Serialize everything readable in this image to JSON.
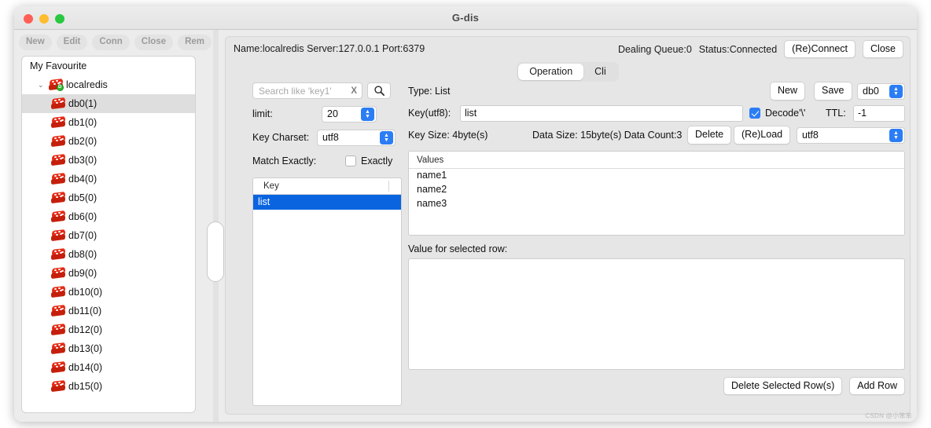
{
  "window": {
    "title": "G-dis"
  },
  "left_toolbar": {
    "buttons": [
      {
        "label": "New",
        "name": "new"
      },
      {
        "label": "Edit",
        "name": "edit"
      },
      {
        "label": "Conn",
        "name": "conn"
      },
      {
        "label": "Close",
        "name": "close"
      },
      {
        "label": "Rem",
        "name": "rem"
      }
    ]
  },
  "sidebar": {
    "root_label": "My Favourite",
    "server_label": "localredis",
    "caret": "⌄",
    "databases": [
      {
        "label": "db0(1)",
        "selected": true
      },
      {
        "label": "db1(0)",
        "selected": false
      },
      {
        "label": "db2(0)",
        "selected": false
      },
      {
        "label": "db3(0)",
        "selected": false
      },
      {
        "label": "db4(0)",
        "selected": false
      },
      {
        "label": "db5(0)",
        "selected": false
      },
      {
        "label": "db6(0)",
        "selected": false
      },
      {
        "label": "db7(0)",
        "selected": false
      },
      {
        "label": "db8(0)",
        "selected": false
      },
      {
        "label": "db9(0)",
        "selected": false
      },
      {
        "label": "db10(0)",
        "selected": false
      },
      {
        "label": "db11(0)",
        "selected": false
      },
      {
        "label": "db12(0)",
        "selected": false
      },
      {
        "label": "db13(0)",
        "selected": false
      },
      {
        "label": "db14(0)",
        "selected": false
      },
      {
        "label": "db15(0)",
        "selected": false
      }
    ]
  },
  "connection_bar": {
    "info": "Name:localredis Server:127.0.0.1 Port:6379",
    "dealing_queue": "Dealing Queue:0",
    "status": "Status:Connected",
    "reconnect_label": "(Re)Connect",
    "close_label": "Close"
  },
  "tabs": {
    "items": [
      {
        "label": "Operation",
        "active": true
      },
      {
        "label": "Cli",
        "active": false
      }
    ]
  },
  "search_panel": {
    "search_placeholder": "Search like 'key1'",
    "search_value": "",
    "clear_glyph": "X",
    "limit_label": "limit:",
    "limit_value": "20",
    "key_charset_label": "Key Charset:",
    "key_charset_value": "utf8",
    "match_exactly_label": "Match Exactly:",
    "exactly_label": "Exactly",
    "exactly_checked": false
  },
  "key_list": {
    "header": "Key",
    "rows": [
      {
        "label": "list",
        "selected": true
      }
    ]
  },
  "detail": {
    "type_label": "Type: List",
    "key_label": "Key(utf8):",
    "key_value": "list",
    "decode_label": "Decode'\\'",
    "decode_checked": true,
    "ttl_label": "TTL:",
    "ttl_value": "-1",
    "key_size": "Key Size: 4byte(s)",
    "data_size": "Data Size: 15byte(s) Data Count:3",
    "delete_label": "Delete",
    "reload_label": "(Re)Load",
    "value_charset_value": "utf8",
    "new_label": "New",
    "save_label": "Save",
    "db_select_value": "db0"
  },
  "values_table": {
    "header": "Values",
    "rows": [
      "name1",
      "name2",
      "name3"
    ]
  },
  "value_editor": {
    "label": "Value for selected row:",
    "content": ""
  },
  "bottom_buttons": {
    "delete_rows_label": "Delete Selected Row(s)",
    "add_row_label": "Add Row"
  },
  "watermark": {
    "text": "CSDN @小笨笨"
  },
  "colors": {
    "accent_blue": "#2b7df6",
    "selection_blue": "#0a64e0",
    "redis_red": "#e42b16",
    "connected_green": "#2fbb2f"
  }
}
